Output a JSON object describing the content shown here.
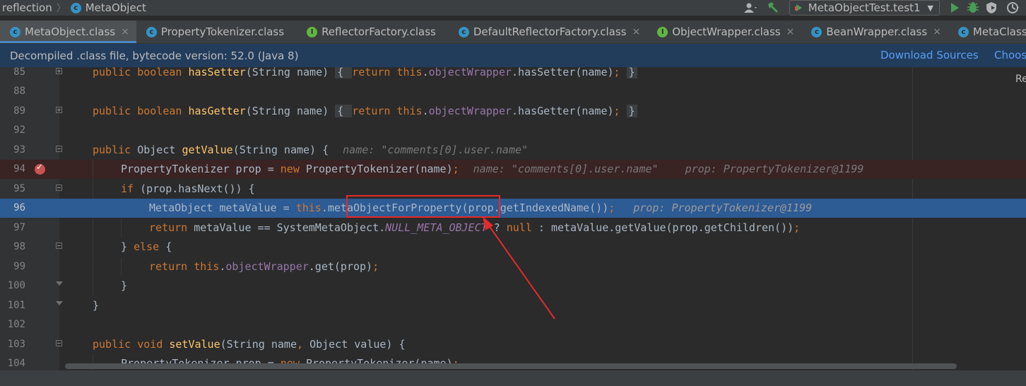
{
  "navbar": {
    "crumbs": [
      "reflection",
      "MetaObject"
    ],
    "run_config": "MetaObjectTest.test1",
    "tools": [
      "user-icon",
      "hammer-icon",
      "run-icon",
      "debug-icon",
      "coverage-icon",
      "profile-icon"
    ]
  },
  "tabs": [
    {
      "label": "MetaObject.class",
      "icon": "class-icon",
      "active": true,
      "close": "×"
    },
    {
      "label": "PropertyTokenizer.class",
      "icon": "class-icon",
      "active": false,
      "close": ""
    },
    {
      "label": "ReflectorFactory.class",
      "icon": "interface-icon",
      "active": false,
      "close": ""
    },
    {
      "label": "DefaultReflectorFactory.class",
      "icon": "class-icon",
      "active": false,
      "close": "×"
    },
    {
      "label": "ObjectWrapper.class",
      "icon": "interface-icon",
      "active": false,
      "close": "×"
    },
    {
      "label": "BeanWrapper.class",
      "icon": "class-icon",
      "active": false,
      "close": "×"
    },
    {
      "label": "MetaClass.c",
      "icon": "class-icon",
      "active": false,
      "close": ""
    }
  ],
  "banner": {
    "message": "Decompiled .class file, bytecode version: 52.0 (Java 8)",
    "download_sources": "Download Sources",
    "choose_sources": "Choos"
  },
  "editor": {
    "reader_label": "Re",
    "line_numbers": [
      "85",
      "88",
      "89",
      "92",
      "93",
      "94",
      "95",
      "96",
      "97",
      "98",
      "99",
      "100",
      "101",
      "102",
      "103",
      "104"
    ],
    "breakpoint_line": "94",
    "current_line": "96",
    "lines": {
      "l85": {
        "t1": "public boolean ",
        "t2": "hasSetter",
        "t3": "(String name) ",
        "t4": "{ ",
        "t5": "return this",
        "t6": ".",
        "t7": "objectWrapper",
        "t8": ".hasSetter(name)",
        "t9": "; ",
        "t10": "}"
      },
      "l89": {
        "t1": "public boolean ",
        "t2": "hasGetter",
        "t3": "(String name) ",
        "t4": "{ ",
        "t5": "return this",
        "t6": ".",
        "t7": "objectWrapper",
        "t8": ".hasGetter(name)",
        "t9": "; ",
        "t10": "}"
      },
      "l93": {
        "t1": "public ",
        "t2": "Object ",
        "t3": "getValue",
        "t4": "(String name) {",
        "hint": "name: \"comments[0].user.name\""
      },
      "l94": {
        "t1": "PropertyTokenizer prop = ",
        "t2": "new ",
        "t3": "PropertyTokenizer(name)",
        "t4": ";",
        "hint1": "name: \"comments[0].user.name\"",
        "hint2": "prop: PropertyTokenizer@1199"
      },
      "l95": {
        "t1": "if ",
        "t2": "(prop.hasNext()) {"
      },
      "l96": {
        "t1": "MetaObject metaValue = ",
        "t2": "this",
        "t3": ".",
        "t4": "metaObjectForProperty",
        "t5": "(prop.getIndexedName())",
        "t6": ";",
        "hint": "prop: PropertyTokenizer@1199"
      },
      "l97": {
        "t1": "return ",
        "t2": "metaValue == SystemMetaObject.",
        "t3": "NULL_META_OBJECT",
        "t4": " ? ",
        "t5": "null",
        "t6": " : metaValue.getValue(prop.getChildren())",
        "t7": ";"
      },
      "l98": {
        "t1": "} ",
        "t2": "else ",
        "t3": "{"
      },
      "l99": {
        "t1": "return this",
        "t2": ".",
        "t3": "objectWrapper",
        "t4": ".get(prop)",
        "t5": ";"
      },
      "l100": {
        "t1": "}"
      },
      "l101": {
        "t1": "}"
      },
      "l103": {
        "t1": "public void ",
        "t2": "setValue",
        "t3": "(String name",
        "t4": ", ",
        "t5": "Object value) {"
      },
      "l104": {
        "t1": "PropertyTokenizer prop = ",
        "t2": "new ",
        "t3": "PropertyTokenizer(name)",
        "t4": ";"
      }
    }
  },
  "colors": {
    "keyword": "#cc7832",
    "method": "#ffc66d",
    "field": "#9876aa",
    "hint": "#787878",
    "current_line": "#2d5b94",
    "breakpoint": "#c75450",
    "annotation": "#e32a2a"
  }
}
